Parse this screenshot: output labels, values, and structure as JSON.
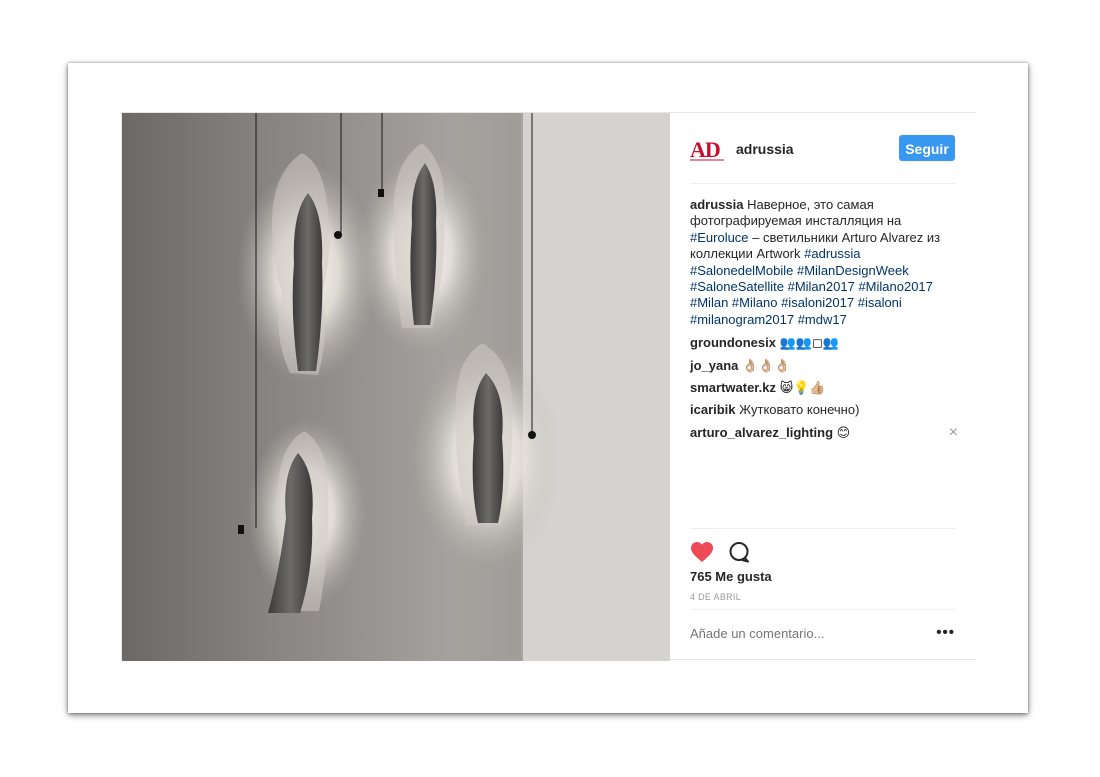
{
  "post": {
    "username": "adrussia",
    "logo_text": "AD",
    "follow_label": "Seguir",
    "caption": {
      "user": "adrussia",
      "parts": [
        {
          "t": "Наверное, это самая фотографируемая инсталляция на "
        },
        {
          "tag": "#Euroluce"
        },
        {
          "t": " – светильники Arturo Alvarez из коллекции Artwork "
        },
        {
          "tag": "#adrussia"
        },
        {
          "t": " "
        },
        {
          "tag": "#SalonedelMobile"
        },
        {
          "t": " "
        },
        {
          "tag": "#MilanDesignWeek"
        },
        {
          "t": " "
        },
        {
          "tag": "#SaloneSatellite"
        },
        {
          "t": " "
        },
        {
          "tag": "#Milan2017"
        },
        {
          "t": " "
        },
        {
          "tag": "#Milano2017"
        },
        {
          "t": " "
        },
        {
          "tag": "#Milan"
        },
        {
          "t": " "
        },
        {
          "tag": "#Milano"
        },
        {
          "t": " "
        },
        {
          "tag": "#isaloni2017"
        },
        {
          "t": " "
        },
        {
          "tag": "#isaloni"
        },
        {
          "t": " "
        },
        {
          "tag": "#milanogram2017"
        },
        {
          "t": " "
        },
        {
          "tag": "#mdw17"
        }
      ]
    },
    "comments": [
      {
        "user": "groundonesix",
        "text": "👥👥◻👥"
      },
      {
        "user": "jo_yana",
        "text": "👌🏼👌🏼👌🏼"
      },
      {
        "user": "smartwater.kz",
        "text": "😸💡👍🏼"
      },
      {
        "user": "icaribik",
        "text": "Жутковато конечно)"
      },
      {
        "user": "arturo_alvarez_lighting",
        "text": "😊",
        "close_icon": "×"
      }
    ],
    "likes_label": "765 Me gusta",
    "date_label": "4 DE ABRIL",
    "add_comment_placeholder": "Añade un comentario...",
    "more_label": "•••",
    "colors": {
      "accent": "#3897f0",
      "like": "#ed4956",
      "hashtag": "#003569",
      "brand": "#c8102e"
    }
  }
}
